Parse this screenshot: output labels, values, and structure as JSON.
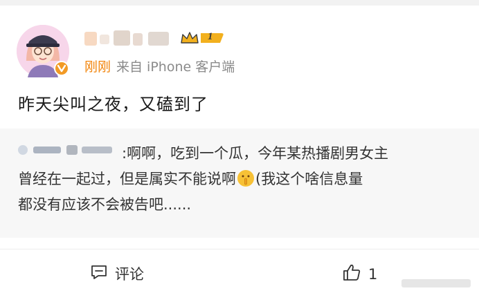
{
  "post": {
    "time": "刚刚",
    "source": "来自 iPhone 客户端",
    "text": "昨天尖叫之夜，又磕到了",
    "level": "1"
  },
  "quote": {
    "line1": ":啊啊，吃到一个瓜，今年某热播剧男女主",
    "line2_a": "曾经在一起过，但是属实不能说啊",
    "line2_b": "(我这个啥信息量",
    "line3": "都没有应该不会被告吧......"
  },
  "actions": {
    "comment_label": "评论",
    "like_count": "1"
  },
  "colors": {
    "time_accent": "#f28308",
    "badge_gold": "#f2b01e",
    "quote_bg": "#f7f7f7"
  },
  "icons": {
    "comment": "comment-icon",
    "like": "thumbs-up-icon",
    "vip": "vip-badge-icon",
    "crown": "crown-icon"
  }
}
